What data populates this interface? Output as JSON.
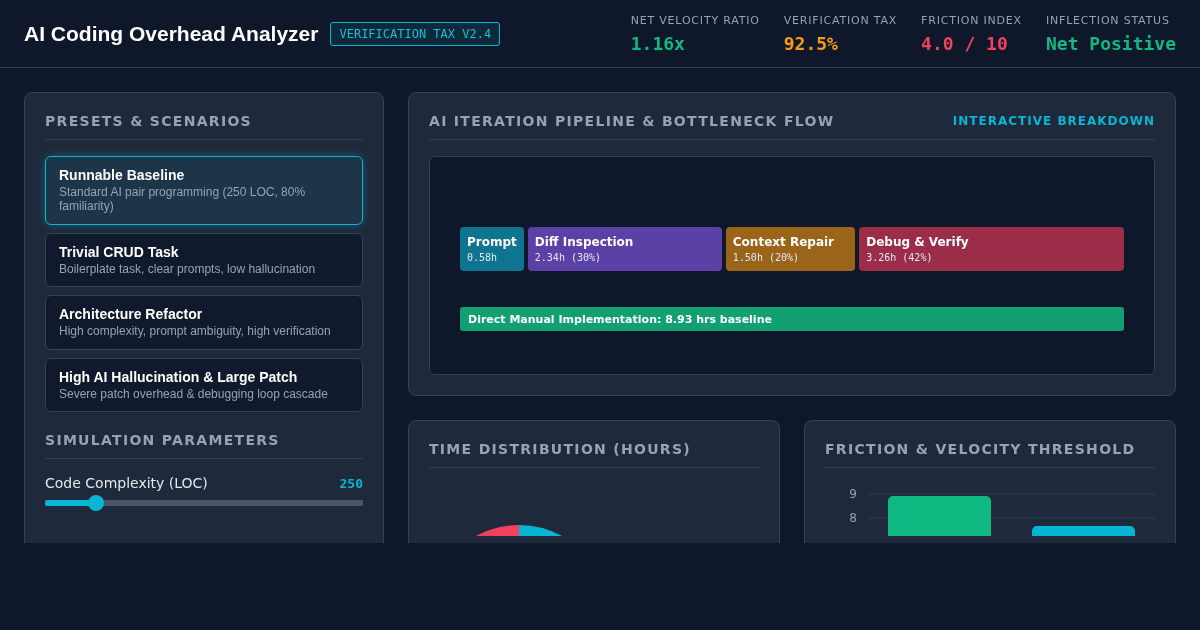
{
  "header": {
    "title": "AI Coding Overhead Analyzer",
    "badge": "VERIFICATION TAX V2.4",
    "stats": [
      {
        "label": "NET VELOCITY RATIO",
        "value": "1.16x",
        "color": "#10b981"
      },
      {
        "label": "VERIFICATION TAX",
        "value": "92.5%",
        "color": "#f59e0b"
      },
      {
        "label": "FRICTION INDEX",
        "value": "4.0 / 10",
        "color": "#f43f5e"
      },
      {
        "label": "INFLECTION STATUS",
        "value": "Net Positive",
        "color": "#10b981"
      }
    ]
  },
  "presets": {
    "title": "PRESETS & SCENARIOS",
    "items": [
      {
        "name": "Runnable Baseline",
        "description": "Standard AI pair programming (250 LOC, 80% familiarity)",
        "selected": true
      },
      {
        "name": "Trivial CRUD Task",
        "description": "Boilerplate task, clear prompts, low hallucination",
        "selected": false
      },
      {
        "name": "Architecture Refactor",
        "description": "High complexity, prompt ambiguity, high verification",
        "selected": false
      },
      {
        "name": "High AI Hallucination & Large Patch",
        "description": "Severe patch overhead & debugging loop cascade",
        "selected": false
      }
    ]
  },
  "parameters": {
    "title": "SIMULATION PARAMETERS",
    "sliders": [
      {
        "label": "Code Complexity (LOC)",
        "reading": "250",
        "level": 0.16
      }
    ]
  },
  "pipeline": {
    "title": "AI ITERATION PIPELINE & BOTTLENECK FLOW",
    "link": "INTERACTIVE BREAKDOWN",
    "segments": [
      {
        "label": "Prompt",
        "reading": "0.58h",
        "color": "#0e7490"
      },
      {
        "label": "Diff Inspection",
        "reading": "2.34h (30%)",
        "color": "#5b41a6"
      },
      {
        "label": "Context Repair",
        "reading": "1.50h (20%)",
        "color": "#9a6419"
      },
      {
        "label": "Debug & Verify",
        "reading": "3.26h (42%)",
        "color": "#9b2d48"
      }
    ],
    "baseline": {
      "label": "Direct Manual Implementation: 8.93 hrs baseline",
      "color": "#12a073"
    }
  },
  "time_distribution": {
    "title": "TIME DISTRIBUTION (HOURS)"
  },
  "threshold": {
    "title": "FRICTION & VELOCITY THRESHOLD",
    "axis_labels": [
      "9",
      "8"
    ]
  }
}
